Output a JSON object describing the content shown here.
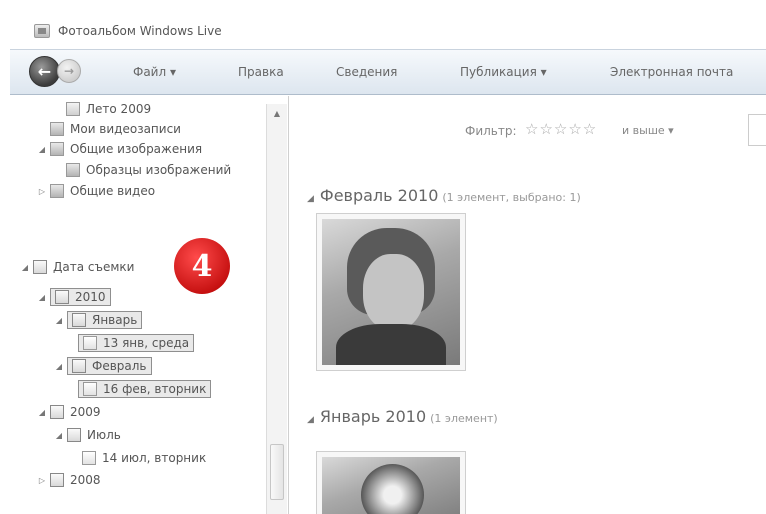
{
  "window": {
    "title": "Фотоальбом Windows Live"
  },
  "menu": {
    "file": "Файл",
    "edit": "Правка",
    "info": "Сведения",
    "publish": "Публикация",
    "email": "Электронная почта"
  },
  "tree": {
    "items": [
      "Лето 2009",
      "Мои видеозаписи",
      "Общие изображения",
      "Образцы изображений",
      "Общие видео",
      "Дата съемки",
      "2010",
      "Январь",
      "13 янв, среда",
      "Февраль",
      "16 фев, вторник",
      "2009",
      "Июль",
      "14 июл, вторник",
      "2008"
    ]
  },
  "badge": {
    "number": "4"
  },
  "filter": {
    "label": "Фильтр:",
    "stars": "☆☆☆☆☆",
    "suffix": "и выше"
  },
  "groups": [
    {
      "title": "Февраль 2010",
      "count": "(1 элемент, выбрано: 1)"
    },
    {
      "title": "Январь 2010",
      "count": "(1 элемент)"
    }
  ]
}
